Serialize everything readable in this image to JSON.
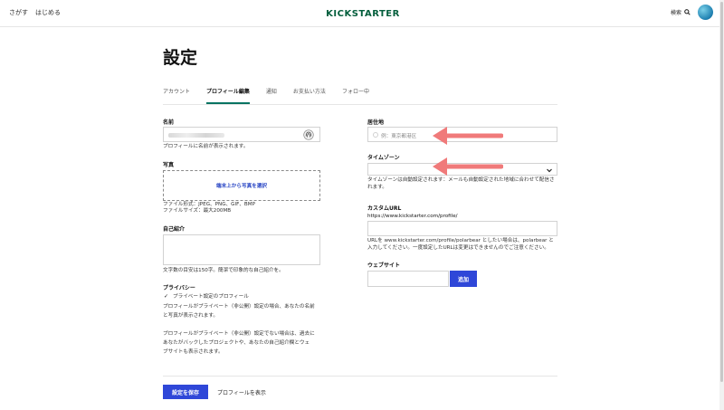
{
  "header": {
    "nav": [
      "さがす",
      "はじめる"
    ],
    "logo_text": "KICKSTARTER",
    "search_label": "検索",
    "logo_color": "#05ce78",
    "logo_dark": "#035e3c"
  },
  "page_title": "設定",
  "tabs": [
    {
      "label": "アカウント"
    },
    {
      "label": "プロフィール編集"
    },
    {
      "label": "通知"
    },
    {
      "label": "お支払い方法"
    },
    {
      "label": "フォロー中"
    }
  ],
  "left": {
    "name_label": "名前",
    "name_help": "プロフィールに名前が表示されます。",
    "photo_label": "写真",
    "photo_button": "端末上から写真を選択",
    "photo_help_1": "ファイル形式：JPEG、PNG、GIF、BMP",
    "photo_help_2": "ファイルサイズ：最大200MB",
    "bio_label": "自己紹介",
    "bio_help": "文字数の目安は150字。簡潔で印象的な自己紹介を。",
    "privacy_label": "プライバシー",
    "privacy_checkbox_label": "プライベート設定のプロフィール",
    "privacy_help_1a": "プロフィールがプライベート（非公開）設定の場合、あなたの名前",
    "privacy_help_1b": "と写真が表示されます。",
    "privacy_help_2a": "プロフィールがプライベート（非公開）設定でない場合は、過去に",
    "privacy_help_2b": "あなたがバックしたプロジェクトや、あなたの自己紹介欄とウェ",
    "privacy_help_2c": "ブサイトも表示されます。"
  },
  "right": {
    "location_label": "居住地",
    "location_placeholder": "例：東京都港区",
    "timezone_label": "タイムゾーン",
    "timezone_value": "",
    "timezone_help": "タイムゾーンは自動設定されます：メールも自動設定された地域に合わせて配信されます。",
    "url_label": "カスタムURL",
    "url_prefix": "https://www.kickstarter.com/profile/",
    "url_help_1": "URLを www.kickstarter.com/profile/polarbear としたい場合は、polarbear と",
    "url_help_2": "入力してください。一度設定したURLは変更はできませんのでご注意ください。",
    "website_label": "ウェブサイト",
    "website_button": "追加"
  },
  "footer": {
    "save_button": "設定を保存",
    "show_profile": "プロフィールを表示"
  },
  "colors": {
    "accent": "#2f47d8",
    "tab_underline": "#037362",
    "annotation_arrow": "#f07a7a"
  }
}
